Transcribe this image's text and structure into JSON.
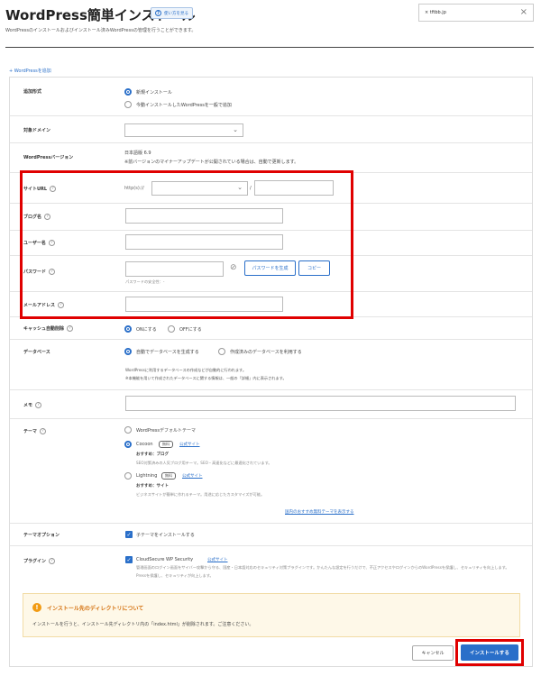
{
  "header": {
    "title": "WordPress簡単インストール",
    "help_label": "使い方を見る",
    "description": "WordPressのインストールおよびインストール済みWordPressの管理を行うことができます。",
    "domain_tag": "tftbb.jp"
  },
  "add_link": "+ WordPressを追加",
  "form": {
    "install_type": {
      "label": "追加形式",
      "options": [
        "新規インストール",
        "今動インストールしたWordPressを一般で追加"
      ],
      "selected": 0
    },
    "target_domain": {
      "label": "対象ドメイン"
    },
    "wp_version": {
      "label": "WordPressバージョン",
      "value": "日本語版 6.9",
      "note": "※前バージョンのマイナーアップデートが公開されている場合は、自動で更新します。"
    },
    "site_url": {
      "label": "サイトURL",
      "prefix": "http(s)://",
      "sep": "/"
    },
    "blog_name": {
      "label": "ブログ名"
    },
    "user_name": {
      "label": "ユーザー名"
    },
    "password": {
      "label": "パスワード",
      "generate_label": "パスワードを生成",
      "copy_label": "コピー",
      "strength": "パスワードの安全性：-"
    },
    "email": {
      "label": "メールアドレス"
    },
    "cache": {
      "label": "キャッシュ自動削除",
      "on": "ONにする",
      "off": "OFFにする"
    },
    "database": {
      "label": "データベース",
      "opt_auto": "自動でデータベースを生成する",
      "opt_existing": "作成済みのデータベースを利用する",
      "note1": "WordPressに利用するデータベースの作成などが自動的に行われます。",
      "note2": "※本機能を用いて作成されたデータベースに関する情報は、一般の「詳細」内に表示されます。"
    },
    "memo": {
      "label": "メモ"
    },
    "theme": {
      "label": "テーマ",
      "opt_default": "WordPressデフォルトテーマ",
      "opt_cocoon": "Cocoon",
      "free_badge": "無料",
      "official_site": "公式サイト",
      "cocoon_rec": "おすすめ：ブログ",
      "cocoon_desc": "SEO対策済みの人気ブログ用テーマ。SEO・高速化などに最適化されています。",
      "opt_lightning": "Lightning",
      "lightning_rec": "おすすめ：サイト",
      "lightning_desc": "ビジネスサイトが簡単に作れるテーマ。用途に応じたカスタマイズが可能。",
      "more_link": "国内のおすすめ無料テーマを表示する"
    },
    "theme_option": {
      "label": "テーマオプション",
      "check_label": "子テーマをインストールする"
    },
    "plugin": {
      "label": "プラグイン",
      "name": "CloudSecure WP Security",
      "desc1": "管理画面のログイン画面をサイバー攻撃から守る、国産・日本語対応のセキュリティ対策プラグインです。かんたんな設定を行うだけで、不正アクセスやログインからのWordPressを保護し、セキュリティを向上します。",
      "desc2": "Pressを保護し、セキュリティが向上します。"
    }
  },
  "notice": {
    "title": "インストール先のディレクトリについて",
    "body": "インストールを行うと、インストール先ディレクトリ内の「index.html」が削除されます。ご注意ください。"
  },
  "buttons": {
    "cancel": "キャンセル",
    "install": "インストールする"
  }
}
